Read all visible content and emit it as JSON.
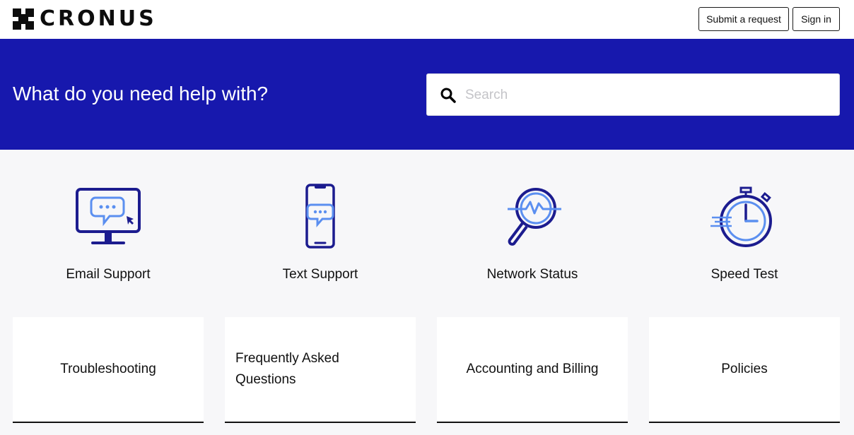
{
  "header": {
    "logo_text": "CRONUS",
    "submit_request_label": "Submit a request",
    "sign_in_label": "Sign in"
  },
  "hero": {
    "title": "What do you need help with?",
    "search": {
      "placeholder": "Search",
      "value": "",
      "icon": "search-icon"
    }
  },
  "services": [
    {
      "label": "Email Support",
      "icon": "monitor-chat-icon"
    },
    {
      "label": "Text Support",
      "icon": "phone-chat-icon"
    },
    {
      "label": "Network Status",
      "icon": "magnifier-pulse-icon"
    },
    {
      "label": "Speed Test",
      "icon": "stopwatch-icon"
    }
  ],
  "categories": [
    {
      "label": "Troubleshooting"
    },
    {
      "label": "Frequently Asked Questions"
    },
    {
      "label": "Accounting and Billing"
    },
    {
      "label": "Policies"
    }
  ],
  "colors": {
    "brand_blue": "#1718ad",
    "icon_dark": "#1c1c8f",
    "icon_light": "#5b8ff0",
    "page_bg": "#f7f7f9"
  }
}
